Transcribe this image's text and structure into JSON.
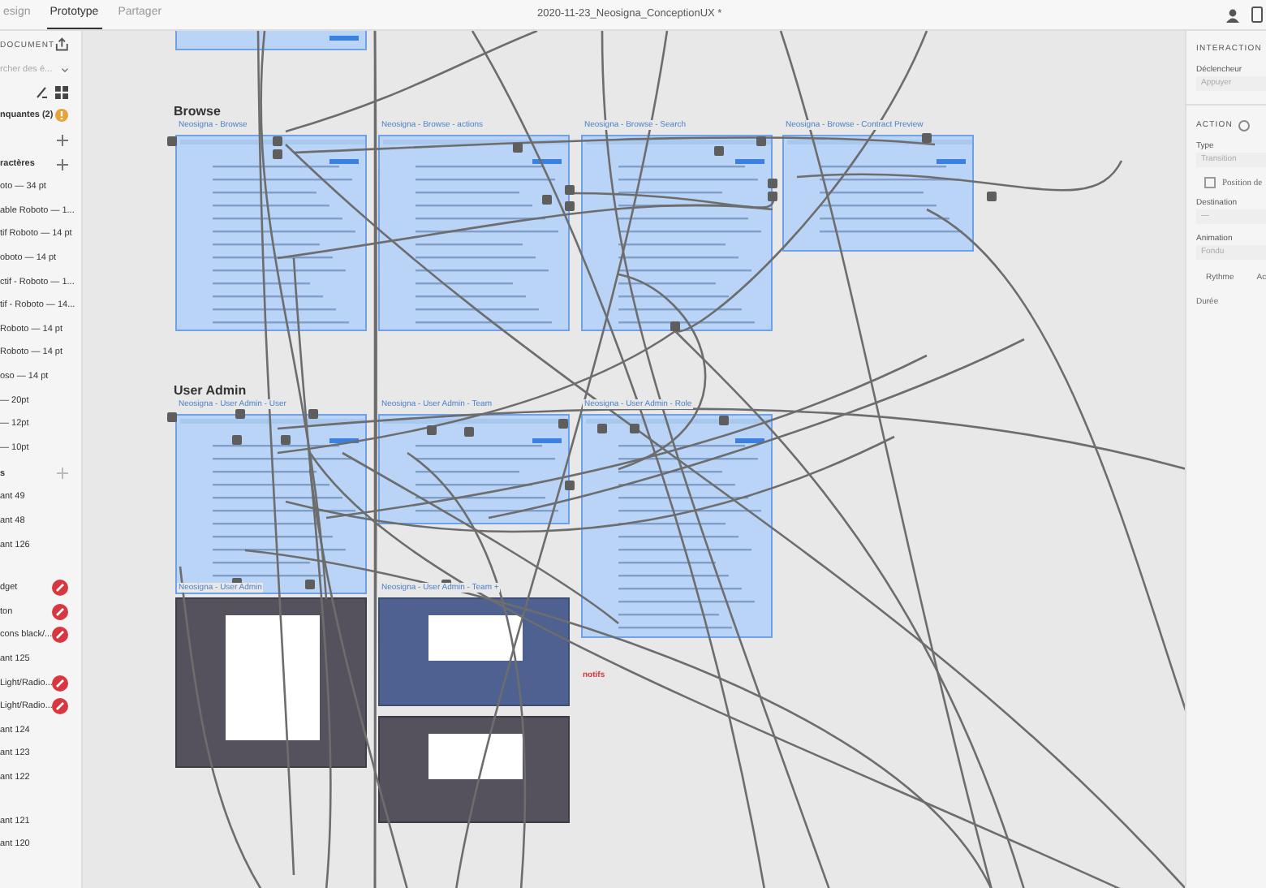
{
  "top_bar": {
    "tabs": [
      {
        "label": "esign",
        "selected": false
      },
      {
        "label": "Prototype",
        "selected": true
      },
      {
        "label": "Partager",
        "selected": false
      }
    ],
    "title": "2020-11-23_Neosigna_ConceptionUX *"
  },
  "left_panel": {
    "header": "DOCUMENT",
    "search": {
      "placeholder": "rcher des é..."
    },
    "alert": "nquantes (2)",
    "section_title": "ractères",
    "styles": [
      "oto — 34 pt",
      "able Roboto — 1...",
      "tif Roboto — 14 pt",
      "oboto — 14 pt",
      "ctif - Roboto — 1...",
      "tif - Roboto — 14...",
      "Roboto — 14 pt",
      "Roboto — 14 pt",
      "oso — 14 pt",
      "— 20pt",
      "— 12pt",
      "— 10pt"
    ],
    "components_title": "s",
    "components": [
      {
        "label": "ant 49",
        "flagged": false
      },
      {
        "label": "ant 48",
        "flagged": false
      },
      {
        "label": "ant 126",
        "flagged": false
      },
      {
        "kind": "gap"
      },
      {
        "label": "dget",
        "flagged": true
      },
      {
        "label": "ton",
        "flagged": true
      },
      {
        "label": "cons black/...",
        "flagged": true
      },
      {
        "label": "ant 125",
        "flagged": false
      },
      {
        "label": "Light/Radio...",
        "flagged": true
      },
      {
        "label": "Light/Radio...",
        "flagged": true
      },
      {
        "label": "ant 124",
        "flagged": false
      },
      {
        "label": "ant 123",
        "flagged": false
      },
      {
        "label": "ant 122",
        "flagged": false
      },
      {
        "kind": "gap"
      },
      {
        "label": "ant 121",
        "flagged": false
      },
      {
        "label": "ant 120",
        "flagged": false
      }
    ]
  },
  "canvas": {
    "groups": [
      "Browse",
      "User Admin"
    ],
    "artboards": [
      {
        "kind": "light"
      },
      {
        "label": "Neosigna - Browse",
        "kind": "light"
      },
      {
        "label": "Neosigna - Browse - actions",
        "kind": "light"
      },
      {
        "label": "Neosigna - Browse - Search",
        "kind": "light"
      },
      {
        "label": "Neosigna - Browse - Contract Preview",
        "kind": "light"
      },
      {
        "label": "Neosigna - User Admin - User",
        "kind": "light"
      },
      {
        "label": "Neosigna - User Admin - Team",
        "kind": "light"
      },
      {
        "label": "Neosigna - User Admin - Role",
        "kind": "light"
      },
      {
        "label": "Neosigna - User Admin",
        "kind": "dark"
      },
      {
        "label": "Neosigna - User Admin - Team +",
        "kind": "navy"
      },
      {
        "kind": "dark"
      }
    ],
    "note": "notifs"
  },
  "right_panel": {
    "interaction_title": "INTERACTION",
    "trigger_label": "Déclencheur",
    "trigger_value": "Appuyer",
    "action_title": "ACTION",
    "type_label": "Type",
    "type_value": "Transition",
    "preserve_label": "Position de",
    "preserve_checked": false,
    "destination_label": "Destination",
    "destination_value": "—",
    "animation_label": "Animation",
    "animation_value": "Fondu",
    "easing_label": "Rythme",
    "easing_value": "Ac",
    "duration_label": "Durée"
  }
}
